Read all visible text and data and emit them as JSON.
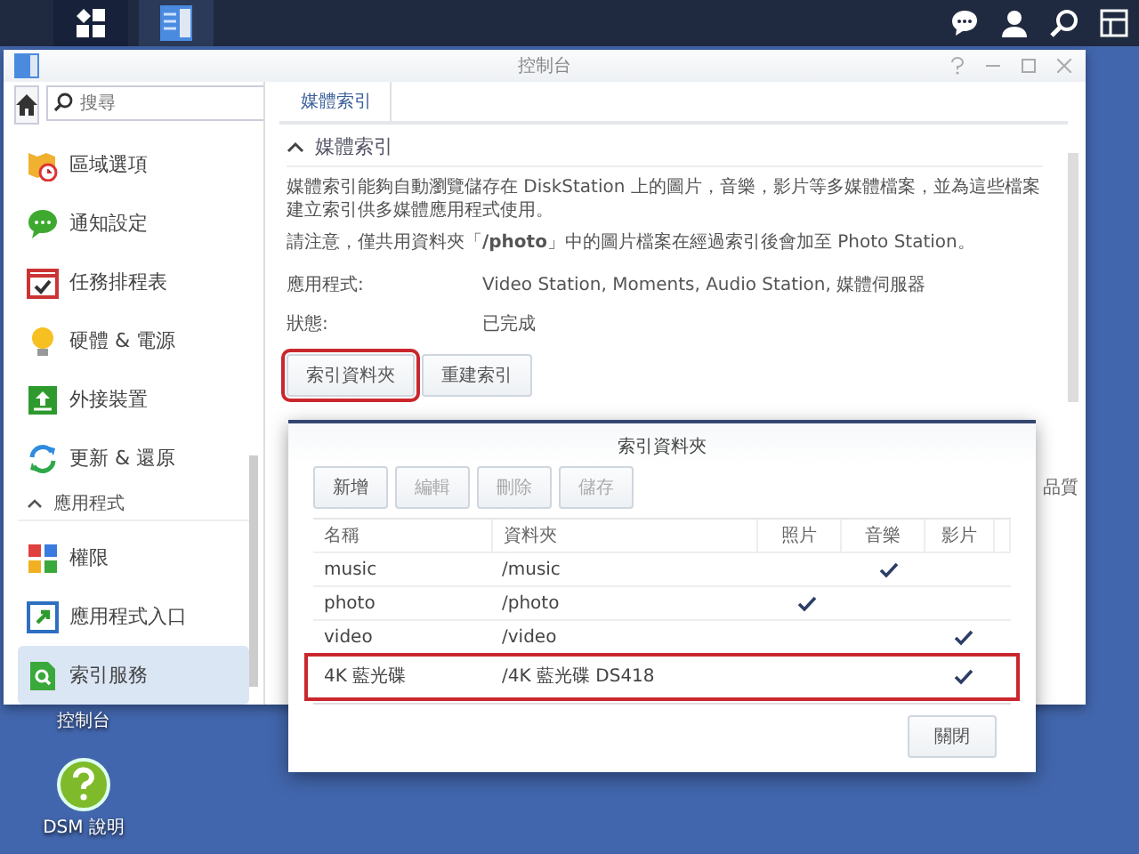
{
  "window": {
    "title": "控制台",
    "search": {
      "placeholder": "搜尋"
    }
  },
  "sidebar": {
    "items": [
      {
        "kind": "item",
        "label": "區域選項",
        "selected": false
      },
      {
        "kind": "item",
        "label": "通知設定",
        "selected": false
      },
      {
        "kind": "item",
        "label": "任務排程表",
        "selected": false
      },
      {
        "kind": "item",
        "label": "硬體 & 電源",
        "selected": false
      },
      {
        "kind": "item",
        "label": "外接裝置",
        "selected": false
      },
      {
        "kind": "item",
        "label": "更新 & 還原",
        "selected": false
      },
      {
        "kind": "section",
        "label": "應用程式",
        "expanded": true
      },
      {
        "kind": "item",
        "label": "權限",
        "selected": false
      },
      {
        "kind": "item",
        "label": "應用程式入口",
        "selected": false
      },
      {
        "kind": "item",
        "label": "索引服務",
        "selected": true
      }
    ]
  },
  "tabs": [
    {
      "label": "媒體索引",
      "selected": true
    }
  ],
  "section": {
    "title": "媒體索引",
    "expanded": true,
    "paragraphs": [
      "媒體索引能夠自動瀏覽儲存在 DiskStation 上的圖片，音樂，影片等多媒體檔案，並為這些檔案建立索引供多媒體應用程式使用。",
      "請注意，僅共用資料夾「**/photo**」中的圖片檔案在經過索引後會加至 Photo Station。"
    ],
    "fields": [
      {
        "label": "應用程式:",
        "value": "Video Station, Moments, Audio Station, 媒體伺服器"
      },
      {
        "label": "狀態:",
        "value": "已完成"
      }
    ],
    "buttons": [
      {
        "label": "索引資料夾",
        "highlighted": true
      },
      {
        "label": "重建索引",
        "highlighted": false
      }
    ],
    "hidden_text": "品質"
  },
  "dialog": {
    "title": "索引資料夾",
    "toolbar": [
      {
        "label": "新增",
        "disabled": false
      },
      {
        "label": "編輯",
        "disabled": true
      },
      {
        "label": "刪除",
        "disabled": true
      },
      {
        "label": "儲存",
        "disabled": true
      }
    ],
    "columns": [
      "名稱",
      "資料夾",
      "照片",
      "音樂",
      "影片"
    ],
    "rows": [
      {
        "name": "music",
        "folder": "/music",
        "photo": false,
        "music": true,
        "video": false,
        "highlighted": false
      },
      {
        "name": "photo",
        "folder": "/photo",
        "photo": true,
        "music": false,
        "video": false,
        "highlighted": false
      },
      {
        "name": "video",
        "folder": "/video",
        "photo": false,
        "music": false,
        "video": true,
        "highlighted": false
      },
      {
        "name": "4K 藍光碟",
        "folder": "/4K 藍光碟 DS418",
        "photo": false,
        "music": false,
        "video": true,
        "highlighted": true
      }
    ],
    "close_button": "關閉"
  },
  "desktop": {
    "icons": [
      {
        "kind": "window",
        "label": "控制台"
      },
      {
        "kind": "help",
        "label": "DSM 說明"
      }
    ]
  }
}
